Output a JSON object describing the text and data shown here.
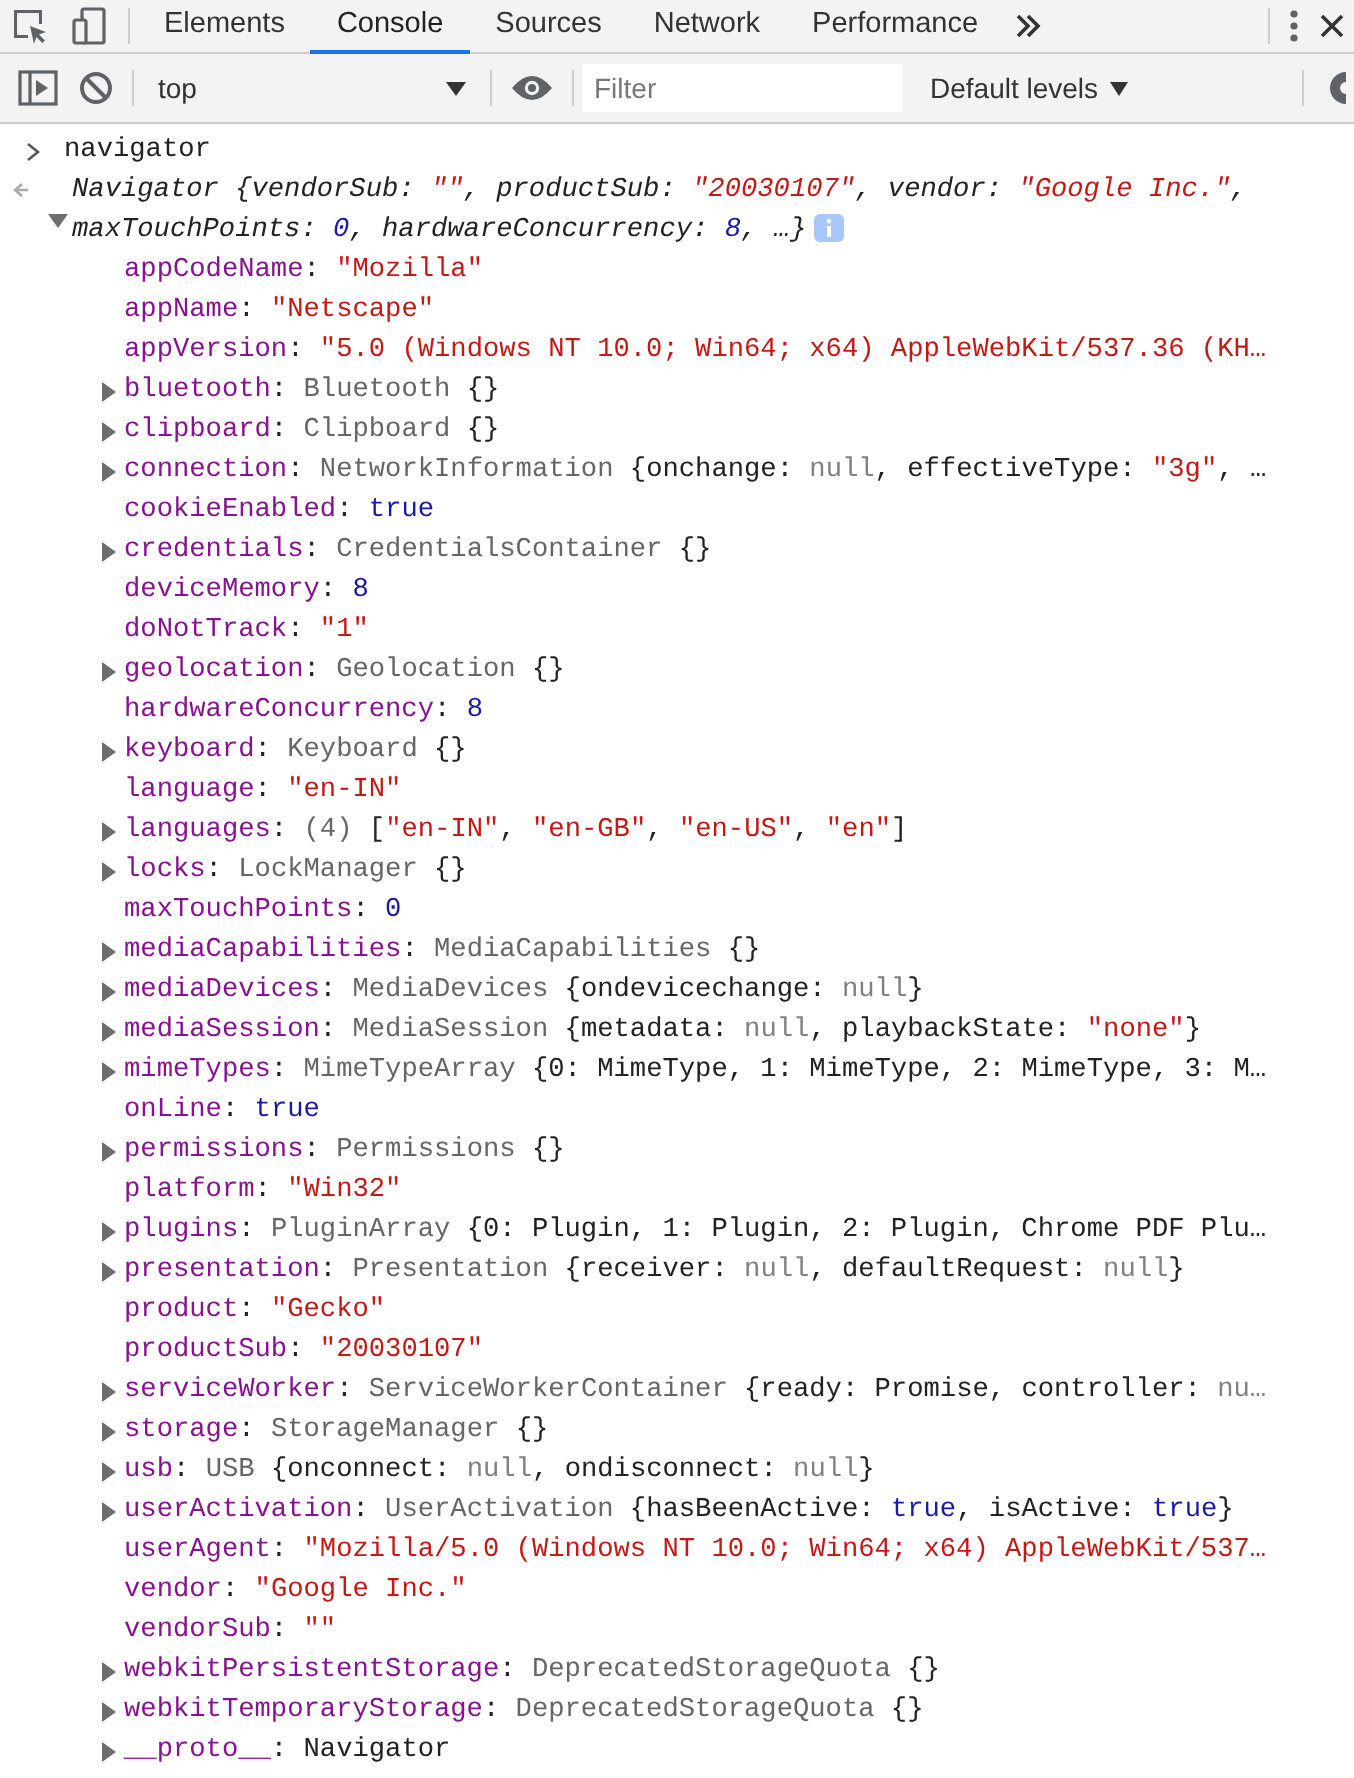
{
  "tabs": [
    {
      "label": "Elements",
      "selected": false
    },
    {
      "label": "Console",
      "selected": true
    },
    {
      "label": "Sources",
      "selected": false
    },
    {
      "label": "Network",
      "selected": false
    },
    {
      "label": "Performance",
      "selected": false
    }
  ],
  "toolbar": {
    "context": "top",
    "filter_placeholder": "Filter",
    "levels": "Default levels"
  },
  "console": {
    "input": "navigator",
    "result": {
      "expanded": true,
      "summary": [
        {
          "kind": "text",
          "text": "Navigator {vendorSub: "
        },
        {
          "kind": "string",
          "text": "\"\""
        },
        {
          "kind": "text",
          "text": ", productSub: "
        },
        {
          "kind": "string",
          "text": "\"20030107\""
        },
        {
          "kind": "text",
          "text": ", vendor: "
        },
        {
          "kind": "string",
          "text": "\"Google Inc.\""
        },
        {
          "kind": "text",
          "text": ", maxTouchPoints: "
        },
        {
          "kind": "number",
          "text": "0"
        },
        {
          "kind": "text",
          "text": ", hardwareConcurrency: "
        },
        {
          "kind": "number",
          "text": "8"
        },
        {
          "kind": "text",
          "text": ", …}"
        }
      ],
      "properties": [
        {
          "key": "appCodeName",
          "expandable": false,
          "value": [
            {
              "kind": "text",
              "text": ": "
            },
            {
              "kind": "string",
              "text": "\"Mozilla\""
            }
          ]
        },
        {
          "key": "appName",
          "expandable": false,
          "value": [
            {
              "kind": "text",
              "text": ": "
            },
            {
              "kind": "string",
              "text": "\"Netscape\""
            }
          ]
        },
        {
          "key": "appVersion",
          "expandable": false,
          "value": [
            {
              "kind": "text",
              "text": ": "
            },
            {
              "kind": "string",
              "text": "\"5.0 (Windows NT 10.0; Win64; x64) AppleWebKit/537.36 (KH…"
            }
          ]
        },
        {
          "key": "bluetooth",
          "expandable": true,
          "value": [
            {
              "kind": "text",
              "text": ": "
            },
            {
              "kind": "type",
              "text": "Bluetooth"
            },
            {
              "kind": "text",
              "text": " {}"
            }
          ]
        },
        {
          "key": "clipboard",
          "expandable": true,
          "value": [
            {
              "kind": "text",
              "text": ": "
            },
            {
              "kind": "type",
              "text": "Clipboard"
            },
            {
              "kind": "text",
              "text": " {}"
            }
          ]
        },
        {
          "key": "connection",
          "expandable": true,
          "value": [
            {
              "kind": "text",
              "text": ": "
            },
            {
              "kind": "type",
              "text": "NetworkInformation"
            },
            {
              "kind": "text",
              "text": " {onchange: "
            },
            {
              "kind": "null",
              "text": "null"
            },
            {
              "kind": "text",
              "text": ", effectiveType: "
            },
            {
              "kind": "string",
              "text": "\"3g\""
            },
            {
              "kind": "text",
              "text": ", …"
            }
          ]
        },
        {
          "key": "cookieEnabled",
          "expandable": false,
          "value": [
            {
              "kind": "text",
              "text": ": "
            },
            {
              "kind": "number",
              "text": "true"
            }
          ]
        },
        {
          "key": "credentials",
          "expandable": true,
          "value": [
            {
              "kind": "text",
              "text": ": "
            },
            {
              "kind": "type",
              "text": "CredentialsContainer"
            },
            {
              "kind": "text",
              "text": " {}"
            }
          ]
        },
        {
          "key": "deviceMemory",
          "expandable": false,
          "value": [
            {
              "kind": "text",
              "text": ": "
            },
            {
              "kind": "number",
              "text": "8"
            }
          ]
        },
        {
          "key": "doNotTrack",
          "expandable": false,
          "value": [
            {
              "kind": "text",
              "text": ": "
            },
            {
              "kind": "string",
              "text": "\"1\""
            }
          ]
        },
        {
          "key": "geolocation",
          "expandable": true,
          "value": [
            {
              "kind": "text",
              "text": ": "
            },
            {
              "kind": "type",
              "text": "Geolocation"
            },
            {
              "kind": "text",
              "text": " {}"
            }
          ]
        },
        {
          "key": "hardwareConcurrency",
          "expandable": false,
          "value": [
            {
              "kind": "text",
              "text": ": "
            },
            {
              "kind": "number",
              "text": "8"
            }
          ]
        },
        {
          "key": "keyboard",
          "expandable": true,
          "value": [
            {
              "kind": "text",
              "text": ": "
            },
            {
              "kind": "type",
              "text": "Keyboard"
            },
            {
              "kind": "text",
              "text": " {}"
            }
          ]
        },
        {
          "key": "language",
          "expandable": false,
          "value": [
            {
              "kind": "text",
              "text": ": "
            },
            {
              "kind": "string",
              "text": "\"en-IN\""
            }
          ]
        },
        {
          "key": "languages",
          "expandable": true,
          "value": [
            {
              "kind": "text",
              "text": ": "
            },
            {
              "kind": "type",
              "text": "(4)"
            },
            {
              "kind": "text",
              "text": " ["
            },
            {
              "kind": "string",
              "text": "\"en-IN\""
            },
            {
              "kind": "text",
              "text": ", "
            },
            {
              "kind": "string",
              "text": "\"en-GB\""
            },
            {
              "kind": "text",
              "text": ", "
            },
            {
              "kind": "string",
              "text": "\"en-US\""
            },
            {
              "kind": "text",
              "text": ", "
            },
            {
              "kind": "string",
              "text": "\"en\""
            },
            {
              "kind": "text",
              "text": "]"
            }
          ]
        },
        {
          "key": "locks",
          "expandable": true,
          "value": [
            {
              "kind": "text",
              "text": ": "
            },
            {
              "kind": "type",
              "text": "LockManager"
            },
            {
              "kind": "text",
              "text": " {}"
            }
          ]
        },
        {
          "key": "maxTouchPoints",
          "expandable": false,
          "value": [
            {
              "kind": "text",
              "text": ": "
            },
            {
              "kind": "number",
              "text": "0"
            }
          ]
        },
        {
          "key": "mediaCapabilities",
          "expandable": true,
          "value": [
            {
              "kind": "text",
              "text": ": "
            },
            {
              "kind": "type",
              "text": "MediaCapabilities"
            },
            {
              "kind": "text",
              "text": " {}"
            }
          ]
        },
        {
          "key": "mediaDevices",
          "expandable": true,
          "value": [
            {
              "kind": "text",
              "text": ": "
            },
            {
              "kind": "type",
              "text": "MediaDevices"
            },
            {
              "kind": "text",
              "text": " {ondevicechange: "
            },
            {
              "kind": "null",
              "text": "null"
            },
            {
              "kind": "text",
              "text": "}"
            }
          ]
        },
        {
          "key": "mediaSession",
          "expandable": true,
          "value": [
            {
              "kind": "text",
              "text": ": "
            },
            {
              "kind": "type",
              "text": "MediaSession"
            },
            {
              "kind": "text",
              "text": " {metadata: "
            },
            {
              "kind": "null",
              "text": "null"
            },
            {
              "kind": "text",
              "text": ", playbackState: "
            },
            {
              "kind": "string",
              "text": "\"none\""
            },
            {
              "kind": "text",
              "text": "}"
            }
          ]
        },
        {
          "key": "mimeTypes",
          "expandable": true,
          "value": [
            {
              "kind": "text",
              "text": ": "
            },
            {
              "kind": "type",
              "text": "MimeTypeArray"
            },
            {
              "kind": "text",
              "text": " {0: MimeType, 1: MimeType, 2: MimeType, 3: M…"
            }
          ]
        },
        {
          "key": "onLine",
          "expandable": false,
          "value": [
            {
              "kind": "text",
              "text": ": "
            },
            {
              "kind": "number",
              "text": "true"
            }
          ]
        },
        {
          "key": "permissions",
          "expandable": true,
          "value": [
            {
              "kind": "text",
              "text": ": "
            },
            {
              "kind": "type",
              "text": "Permissions"
            },
            {
              "kind": "text",
              "text": " {}"
            }
          ]
        },
        {
          "key": "platform",
          "expandable": false,
          "value": [
            {
              "kind": "text",
              "text": ": "
            },
            {
              "kind": "string",
              "text": "\"Win32\""
            }
          ]
        },
        {
          "key": "plugins",
          "expandable": true,
          "value": [
            {
              "kind": "text",
              "text": ": "
            },
            {
              "kind": "type",
              "text": "PluginArray"
            },
            {
              "kind": "text",
              "text": " {0: Plugin, 1: Plugin, 2: Plugin, Chrome PDF Plu…"
            }
          ]
        },
        {
          "key": "presentation",
          "expandable": true,
          "value": [
            {
              "kind": "text",
              "text": ": "
            },
            {
              "kind": "type",
              "text": "Presentation"
            },
            {
              "kind": "text",
              "text": " {receiver: "
            },
            {
              "kind": "null",
              "text": "null"
            },
            {
              "kind": "text",
              "text": ", defaultRequest: "
            },
            {
              "kind": "null",
              "text": "null"
            },
            {
              "kind": "text",
              "text": "}"
            }
          ]
        },
        {
          "key": "product",
          "expandable": false,
          "value": [
            {
              "kind": "text",
              "text": ": "
            },
            {
              "kind": "string",
              "text": "\"Gecko\""
            }
          ]
        },
        {
          "key": "productSub",
          "expandable": false,
          "value": [
            {
              "kind": "text",
              "text": ": "
            },
            {
              "kind": "string",
              "text": "\"20030107\""
            }
          ]
        },
        {
          "key": "serviceWorker",
          "expandable": true,
          "value": [
            {
              "kind": "text",
              "text": ": "
            },
            {
              "kind": "type",
              "text": "ServiceWorkerContainer"
            },
            {
              "kind": "text",
              "text": " {ready: Promise, controller: "
            },
            {
              "kind": "null",
              "text": "nu…"
            }
          ]
        },
        {
          "key": "storage",
          "expandable": true,
          "value": [
            {
              "kind": "text",
              "text": ": "
            },
            {
              "kind": "type",
              "text": "StorageManager"
            },
            {
              "kind": "text",
              "text": " {}"
            }
          ]
        },
        {
          "key": "usb",
          "expandable": true,
          "value": [
            {
              "kind": "text",
              "text": ": "
            },
            {
              "kind": "type",
              "text": "USB"
            },
            {
              "kind": "text",
              "text": " {onconnect: "
            },
            {
              "kind": "null",
              "text": "null"
            },
            {
              "kind": "text",
              "text": ", ondisconnect: "
            },
            {
              "kind": "null",
              "text": "null"
            },
            {
              "kind": "text",
              "text": "}"
            }
          ]
        },
        {
          "key": "userActivation",
          "expandable": true,
          "value": [
            {
              "kind": "text",
              "text": ": "
            },
            {
              "kind": "type",
              "text": "UserActivation"
            },
            {
              "kind": "text",
              "text": " {hasBeenActive: "
            },
            {
              "kind": "number",
              "text": "true"
            },
            {
              "kind": "text",
              "text": ", isActive: "
            },
            {
              "kind": "number",
              "text": "true"
            },
            {
              "kind": "text",
              "text": "}"
            }
          ]
        },
        {
          "key": "userAgent",
          "expandable": false,
          "value": [
            {
              "kind": "text",
              "text": ": "
            },
            {
              "kind": "string",
              "text": "\"Mozilla/5.0 (Windows NT 10.0; Win64; x64) AppleWebKit/537…"
            }
          ]
        },
        {
          "key": "vendor",
          "expandable": false,
          "value": [
            {
              "kind": "text",
              "text": ": "
            },
            {
              "kind": "string",
              "text": "\"Google Inc.\""
            }
          ]
        },
        {
          "key": "vendorSub",
          "expandable": false,
          "value": [
            {
              "kind": "text",
              "text": ": "
            },
            {
              "kind": "string",
              "text": "\"\""
            }
          ]
        },
        {
          "key": "webkitPersistentStorage",
          "expandable": true,
          "value": [
            {
              "kind": "text",
              "text": ": "
            },
            {
              "kind": "type",
              "text": "DeprecatedStorageQuota"
            },
            {
              "kind": "text",
              "text": " {}"
            }
          ]
        },
        {
          "key": "webkitTemporaryStorage",
          "expandable": true,
          "value": [
            {
              "kind": "text",
              "text": ": "
            },
            {
              "kind": "type",
              "text": "DeprecatedStorageQuota"
            },
            {
              "kind": "text",
              "text": " {}"
            }
          ]
        },
        {
          "key": "__proto__",
          "expandable": true,
          "value": [
            {
              "kind": "text",
              "text": ": "
            },
            {
              "kind": "text",
              "text": "Navigator"
            }
          ]
        }
      ]
    }
  }
}
